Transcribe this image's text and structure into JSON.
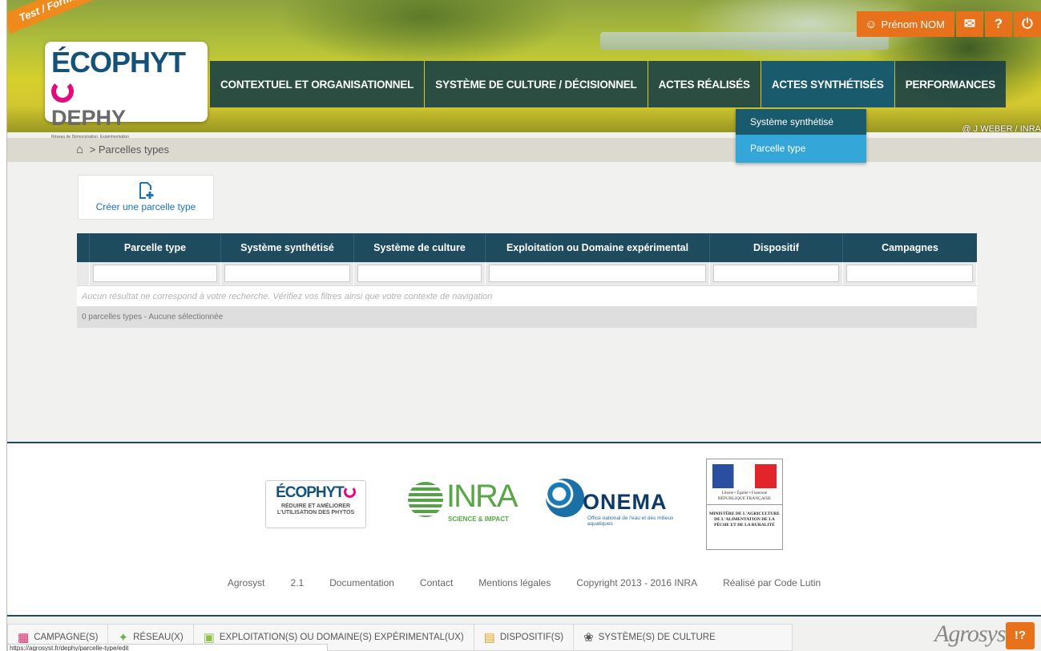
{
  "env_ribbon": "Test / Formation",
  "logo": {
    "line1": "ÉCOPHYT",
    "line2": "DEPHY",
    "tagline": "Réseau de Démonstration, Expérimentation et Production de références sur les systèmes économes en phytosanitaires"
  },
  "photo_credit": "@ J WEBER / INRA",
  "userbar": {
    "user_name": "Prénom NOM",
    "mail_icon": "✉",
    "help_icon": "?",
    "power_icon": "⏻"
  },
  "nav": [
    "CONTEXTUEL ET ORGANISATIONNEL",
    "SYSTÈME DE CULTURE / DÉCISIONNEL",
    "ACTES RÉALISÉS",
    "ACTES SYNTHÉTISÉS",
    "PERFORMANCES"
  ],
  "dropdown": [
    "Système synthétisé",
    "Parcelle type"
  ],
  "breadcrumb": {
    "home_icon": "home-icon",
    "current": "> Parcelles types"
  },
  "create_button": {
    "label": "Créer une parcelle type"
  },
  "table": {
    "columns": [
      "Parcelle type",
      "Système synthétisé",
      "Système de culture",
      "Exploitation ou Domaine expérimental",
      "Dispositif",
      "Campagnes"
    ],
    "empty_message": "Aucun résultat ne correspond à votre recherche. Vérifiez vos filtres ainsi que votre contexte de navigation",
    "footer": "0 parcelles types - Aucune sélectionnée"
  },
  "partners": {
    "ecophyto": {
      "name": "ÉCOPHYT",
      "slogan": "RÉDUIRE ET AMÉLIORER L'UTILISATION DES PHYTOS"
    },
    "inra": {
      "name": "INRA",
      "slogan": "SCIENCE & IMPACT"
    },
    "onema": {
      "name": "ONEMA",
      "slogan": "Office national de l'eau et des milieux aquatiques"
    },
    "ministere": {
      "motto": "Liberté • Égalité • Fraternité",
      "rf": "RÉPUBLIQUE FRANÇAISE",
      "name": "MINISTÈRE DE L'AGRICULTURE DE L'ALIMENTATION DE LA PÊCHE ET DE LA RURALITÉ"
    }
  },
  "footer_links": {
    "app": "Agrosyst",
    "version": "2.1",
    "documentation": "Documentation",
    "contact": "Contact",
    "legal": "Mentions légales",
    "copyright": "Copyright 2013 - 2016 INRA",
    "made_by": "Réalisé par Code Lutin"
  },
  "bottom_bar": [
    {
      "icon": "calendar-icon",
      "label": "CAMPAGNE(S)"
    },
    {
      "icon": "network-icon",
      "label": "RÉSEAU(X)"
    },
    {
      "icon": "farm-icon",
      "label": "EXPLOITATION(S) OU DOMAINE(S) EXPÉRIMENTAL(UX)"
    },
    {
      "icon": "device-icon",
      "label": "DISPOSITIF(S)"
    },
    {
      "icon": "crop-icon",
      "label": "SYSTÈME(S) DE CULTURE"
    }
  ],
  "status_url": "https://agrosyst.fr/dephy/parcelle-type/edit",
  "brand": "Agrosyst",
  "help_button": "!?",
  "colors": {
    "primary": "#1e4b5e",
    "accent": "#e8721c",
    "active_nav": "#1a5a6d",
    "dropdown_hover": "#35a6d8",
    "link": "#1c74b7"
  }
}
